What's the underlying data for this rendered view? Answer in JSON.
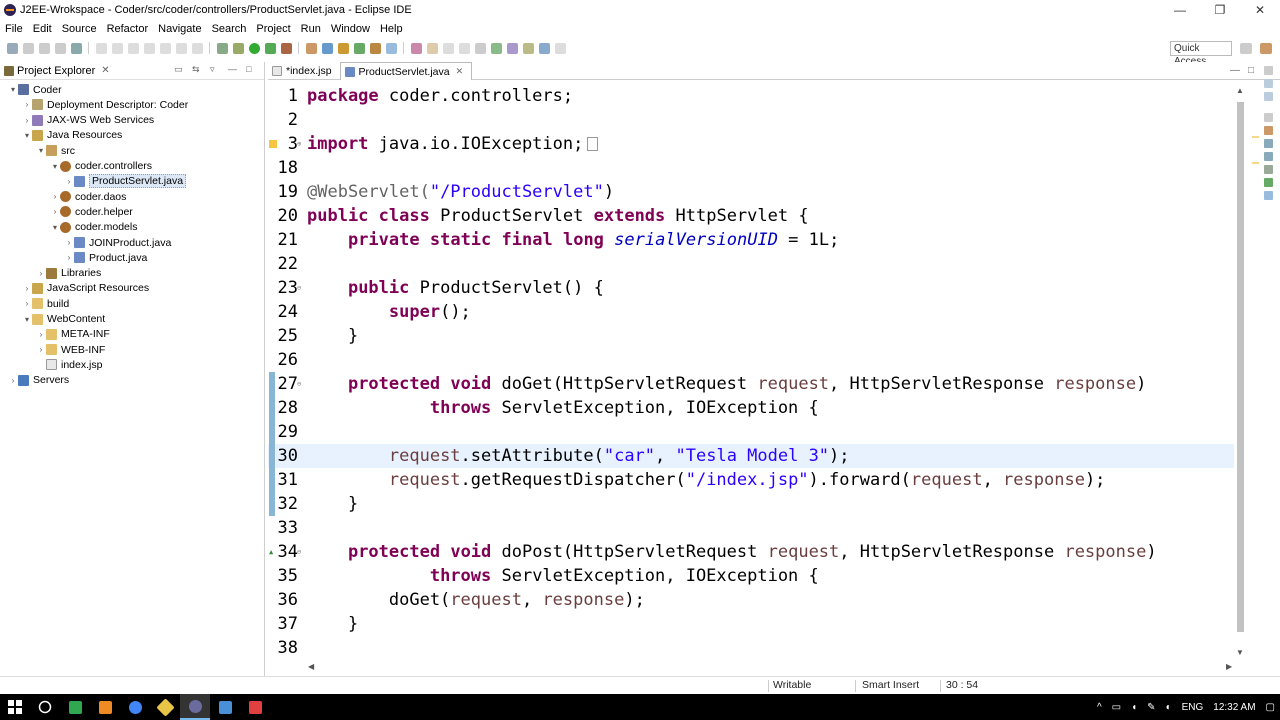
{
  "window": {
    "title": "J2EE-Wrokspace - Coder/src/coder/controllers/ProductServlet.java - Eclipse IDE",
    "minimize": "—",
    "maximize": "❐",
    "close": "✕"
  },
  "menu": [
    "File",
    "Edit",
    "Source",
    "Refactor",
    "Navigate",
    "Search",
    "Project",
    "Run",
    "Window",
    "Help"
  ],
  "toolbar": {
    "quick_access": "Quick Access"
  },
  "explorer": {
    "title": "Project Explorer",
    "tree": [
      {
        "label": "Coder",
        "icon": "project-icon",
        "arrow": "▾"
      },
      {
        "label": "Deployment Descriptor: Coder",
        "icon": "deployment-descriptor-icon",
        "arrow": "›"
      },
      {
        "label": "JAX-WS Web Services",
        "icon": "web-services-icon",
        "arrow": "›"
      },
      {
        "label": "Java Resources",
        "icon": "java-resources-icon",
        "arrow": "▾"
      },
      {
        "label": "src",
        "icon": "source-folder-icon",
        "arrow": "▾"
      },
      {
        "label": "coder.controllers",
        "icon": "package-icon",
        "arrow": "▾"
      },
      {
        "label": "ProductServlet.java",
        "icon": "java-file-icon",
        "arrow": "›"
      },
      {
        "label": "coder.daos",
        "icon": "package-icon",
        "arrow": "›"
      },
      {
        "label": "coder.helper",
        "icon": "package-icon",
        "arrow": "›"
      },
      {
        "label": "coder.models",
        "icon": "package-icon",
        "arrow": "▾"
      },
      {
        "label": "JOINProduct.java",
        "icon": "java-file-icon",
        "arrow": "›"
      },
      {
        "label": "Product.java",
        "icon": "java-file-icon",
        "arrow": "›"
      },
      {
        "label": "Libraries",
        "icon": "libraries-icon",
        "arrow": "›"
      },
      {
        "label": "JavaScript Resources",
        "icon": "javascript-resources-icon",
        "arrow": "›"
      },
      {
        "label": "build",
        "icon": "folder-icon",
        "arrow": "›"
      },
      {
        "label": "WebContent",
        "icon": "folder-icon",
        "arrow": "▾"
      },
      {
        "label": "META-INF",
        "icon": "folder-icon",
        "arrow": "›"
      },
      {
        "label": "WEB-INF",
        "icon": "folder-icon",
        "arrow": "›"
      },
      {
        "label": "index.jsp",
        "icon": "jsp-file-icon",
        "arrow": ""
      },
      {
        "label": "Servers",
        "icon": "servers-icon",
        "arrow": "›"
      }
    ]
  },
  "editor": {
    "tabs": [
      {
        "label": "*index.jsp",
        "active": false
      },
      {
        "label": "ProductServlet.java",
        "active": true
      }
    ],
    "lines": [
      {
        "n": "1"
      },
      {
        "n": "2"
      },
      {
        "n": "3"
      },
      {
        "n": "18"
      },
      {
        "n": "19"
      },
      {
        "n": "20"
      },
      {
        "n": "21"
      },
      {
        "n": "22"
      },
      {
        "n": "23"
      },
      {
        "n": "24"
      },
      {
        "n": "25"
      },
      {
        "n": "26"
      },
      {
        "n": "27"
      },
      {
        "n": "28"
      },
      {
        "n": "29"
      },
      {
        "n": "30"
      },
      {
        "n": "31"
      },
      {
        "n": "32"
      },
      {
        "n": "33"
      },
      {
        "n": "34"
      },
      {
        "n": "35"
      },
      {
        "n": "36"
      },
      {
        "n": "37"
      },
      {
        "n": "38"
      }
    ],
    "tokens": {
      "l1": [
        "package",
        " coder.controllers;"
      ],
      "l3": [
        "import",
        " java.io.IOException;"
      ],
      "l19": [
        "@WebServlet(",
        "\"/ProductServlet\"",
        ")"
      ],
      "l20": [
        "public",
        " ",
        "class",
        " ProductServlet ",
        "extends",
        " HttpServlet {"
      ],
      "l21": [
        "    ",
        "private",
        " ",
        "static",
        " ",
        "final",
        " ",
        "long",
        " ",
        "serialVersionUID",
        " = 1L;"
      ],
      "l23": [
        "    ",
        "public",
        " ProductServlet() {"
      ],
      "l24": [
        "        ",
        "super",
        "();"
      ],
      "l25": [
        "    }"
      ],
      "l27": [
        "    ",
        "protected",
        " ",
        "void",
        " doGet(HttpServletRequest ",
        "request",
        ", HttpServletResponse ",
        "response",
        ")"
      ],
      "l28": [
        "            ",
        "throws",
        " ServletException, IOException {"
      ],
      "l30": [
        "        ",
        "request",
        ".setAttribute(",
        "\"car\"",
        ", ",
        "\"Tesla Model 3\"",
        ");"
      ],
      "l31": [
        "        ",
        "request",
        ".getRequestDispatcher(",
        "\"/index.jsp\"",
        ").forward(",
        "request",
        ", ",
        "response",
        ");"
      ],
      "l32": [
        "    }"
      ],
      "l34": [
        "    ",
        "protected",
        " ",
        "void",
        " doPost(HttpServletRequest ",
        "request",
        ", HttpServletResponse ",
        "response",
        ")"
      ],
      "l35": [
        "            ",
        "throws",
        " ServletException, IOException {"
      ],
      "l36": [
        "        doGet(",
        "request",
        ", ",
        "response",
        ");"
      ],
      "l37": [
        "    }"
      ]
    }
  },
  "status": {
    "writable": "Writable",
    "insert_mode": "Smart Insert",
    "position": "30 : 54"
  },
  "taskbar": {
    "language": "ENG",
    "time": "12:32 AM"
  },
  "colors": {
    "keyword": "#7f0055",
    "string": "#2a00ff",
    "parameter": "#6a3e3e",
    "field": "#0000c0",
    "current_line": "#e8f2fe"
  }
}
